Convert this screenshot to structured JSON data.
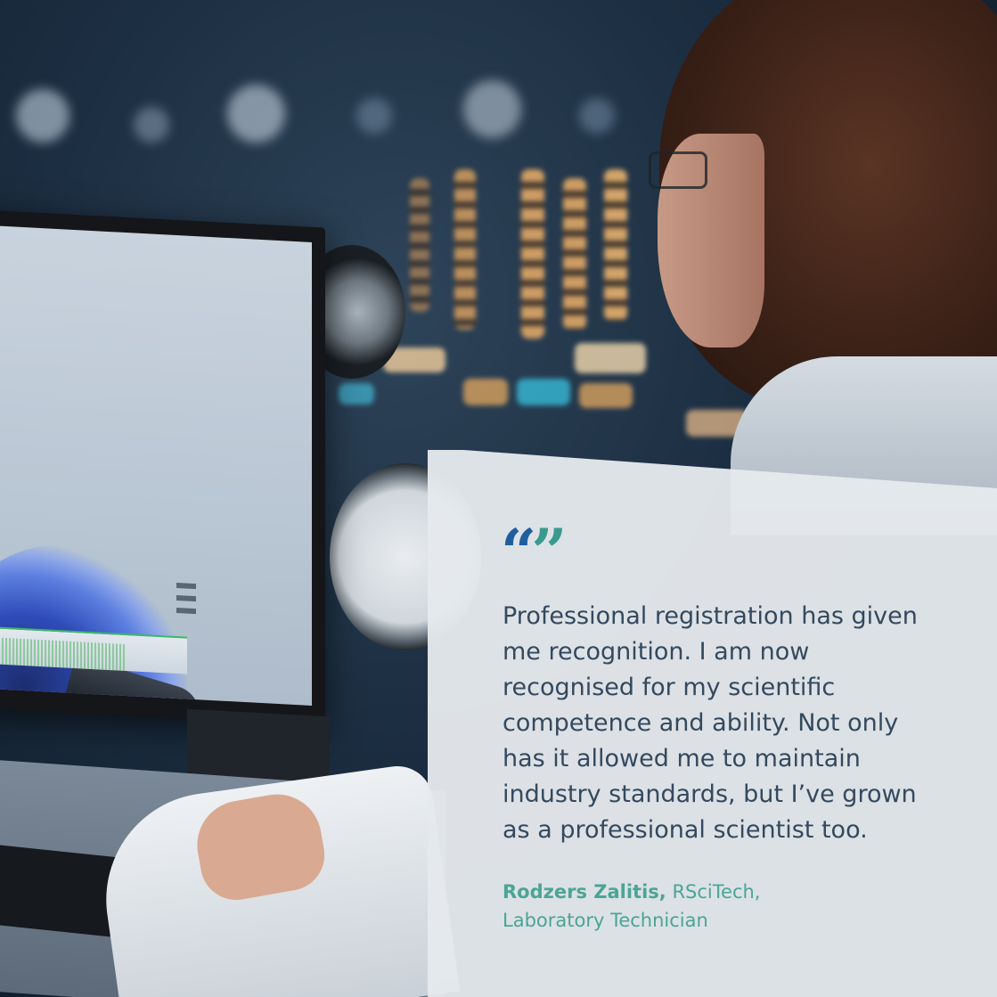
{
  "testimonial": {
    "quote_mark": "“”",
    "quote": "Professional registration has given me recognition. I am now recognised for my scientific competence and ability. Not only has it allowed me to maintain industry standards, but I’ve grown as a professional scientist too.",
    "author_name": "Rodzers Zalitis,",
    "author_credential": " RSciTech,",
    "author_role": "Laboratory Technician"
  },
  "colors": {
    "quote_open": "#1f5f9f",
    "quote_close": "#3a9a8e",
    "attribution": "#4aa596",
    "body_text": "#34495e",
    "card": "#e5e9ed"
  }
}
